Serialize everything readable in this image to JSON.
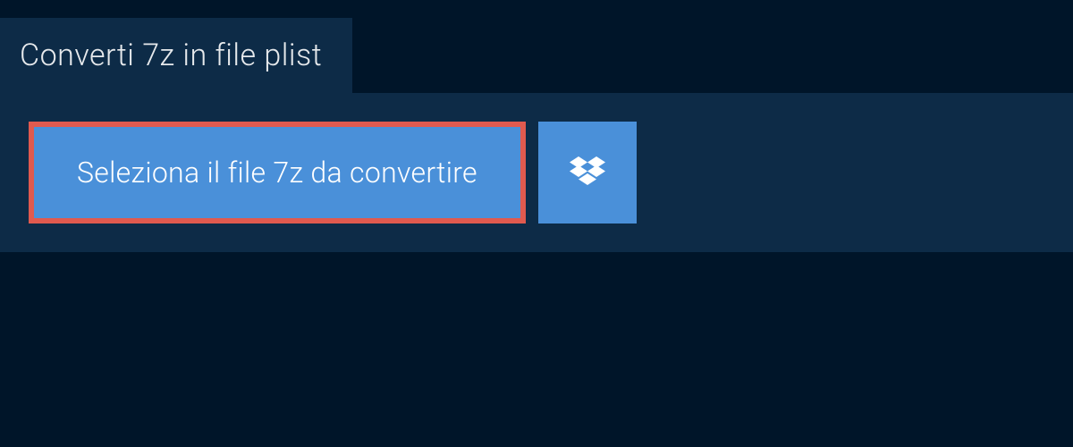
{
  "tab": {
    "title": "Converti 7z in file plist"
  },
  "actions": {
    "select_file_label": "Seleziona il file 7z da convertire"
  }
}
